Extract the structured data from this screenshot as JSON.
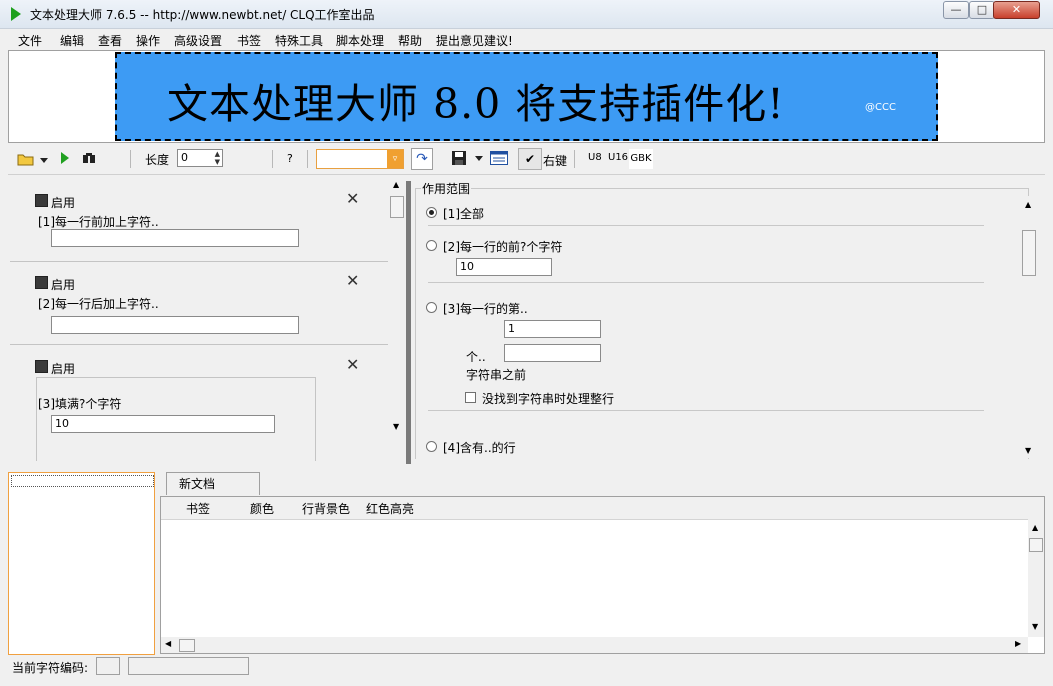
{
  "window": {
    "title": "文本处理大师 7.6.5 -- http://www.newbt.net/  CLQ工作室出品",
    "minimize": "—",
    "maximize": "□",
    "close": "✕"
  },
  "menu": [
    "文件",
    "编辑",
    "查看",
    "操作",
    "高级设置",
    "书签",
    "特殊工具",
    "脚本处理",
    "帮助",
    "提出意见建议!"
  ],
  "banner": {
    "text": "文本处理大师 8.0 将支持插件化!",
    "tag": "@CCC"
  },
  "toolbar": {
    "length_label": "长度",
    "length_value": "0",
    "help": "?",
    "search_value": "",
    "right_click_label": "右键",
    "encodings": [
      "U8",
      "U16",
      "GBK"
    ]
  },
  "actions": [
    {
      "enable_label": "启用",
      "title": "[1]每一行前加上字符..",
      "value": ""
    },
    {
      "enable_label": "启用",
      "title": "[2]每一行后加上字符..",
      "value": ""
    },
    {
      "enable_label": "启用",
      "title": "[3]填满?个字符",
      "value": "10"
    }
  ],
  "scope": {
    "group_label": "作用范围",
    "opt1": "[1]全部",
    "opt2": "[2]每一行的前?个字符",
    "opt2_value": "10",
    "opt3": "[3]每一行的第..",
    "opt3_value": "1",
    "opt3_count_label": "个..",
    "opt3_count_value": "",
    "opt3_suffix": "字符串之前",
    "opt3_check": "没找到字符串时处理整行",
    "opt4": "[4]含有..的行"
  },
  "document": {
    "tab": "新文档",
    "columns": [
      "书签",
      "颜色",
      "行背景色",
      "红色高亮"
    ]
  },
  "status": {
    "encoding_label": "当前字符编码:",
    "encoding_value": "",
    "extra": ""
  }
}
